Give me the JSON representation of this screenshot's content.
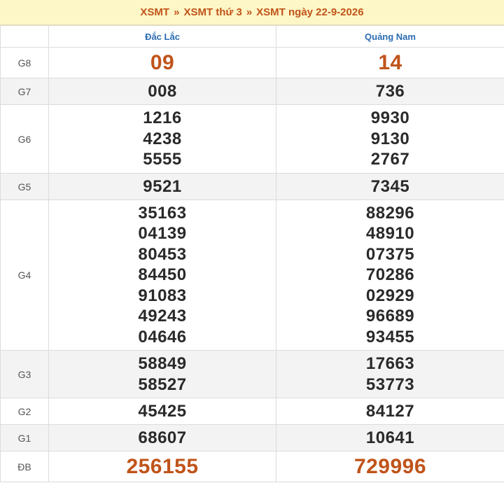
{
  "breadcrumb": {
    "item1": "XSMT",
    "sep": "»",
    "item2": "XSMT thứ 3",
    "item3": "XSMT ngày 22-9-2026"
  },
  "provinces": [
    "Đắc Lắc",
    "Quảng Nam"
  ],
  "prizes": [
    {
      "label": "G8",
      "values": [
        [
          "09"
        ],
        [
          "14"
        ]
      ]
    },
    {
      "label": "G7",
      "values": [
        [
          "008"
        ],
        [
          "736"
        ]
      ]
    },
    {
      "label": "G6",
      "values": [
        [
          "1216",
          "4238",
          "5555"
        ],
        [
          "9930",
          "9130",
          "2767"
        ]
      ]
    },
    {
      "label": "G5",
      "values": [
        [
          "9521"
        ],
        [
          "7345"
        ]
      ]
    },
    {
      "label": "G4",
      "values": [
        [
          "35163",
          "04139",
          "80453",
          "84450",
          "91083",
          "49243",
          "04646"
        ],
        [
          "88296",
          "48910",
          "07375",
          "70286",
          "02929",
          "96689",
          "93455"
        ]
      ]
    },
    {
      "label": "G3",
      "values": [
        [
          "58849",
          "58527"
        ],
        [
          "17663",
          "53773"
        ]
      ]
    },
    {
      "label": "G2",
      "values": [
        [
          "45425"
        ],
        [
          "84127"
        ]
      ]
    },
    {
      "label": "G1",
      "values": [
        [
          "68607"
        ],
        [
          "10641"
        ]
      ]
    },
    {
      "label": "ĐB",
      "values": [
        [
          "256155"
        ],
        [
          "729996"
        ]
      ]
    }
  ],
  "colors": {
    "accent": "#c0541a",
    "province_header": "#2b6cb0",
    "header_bg": "#fdf6c6"
  }
}
